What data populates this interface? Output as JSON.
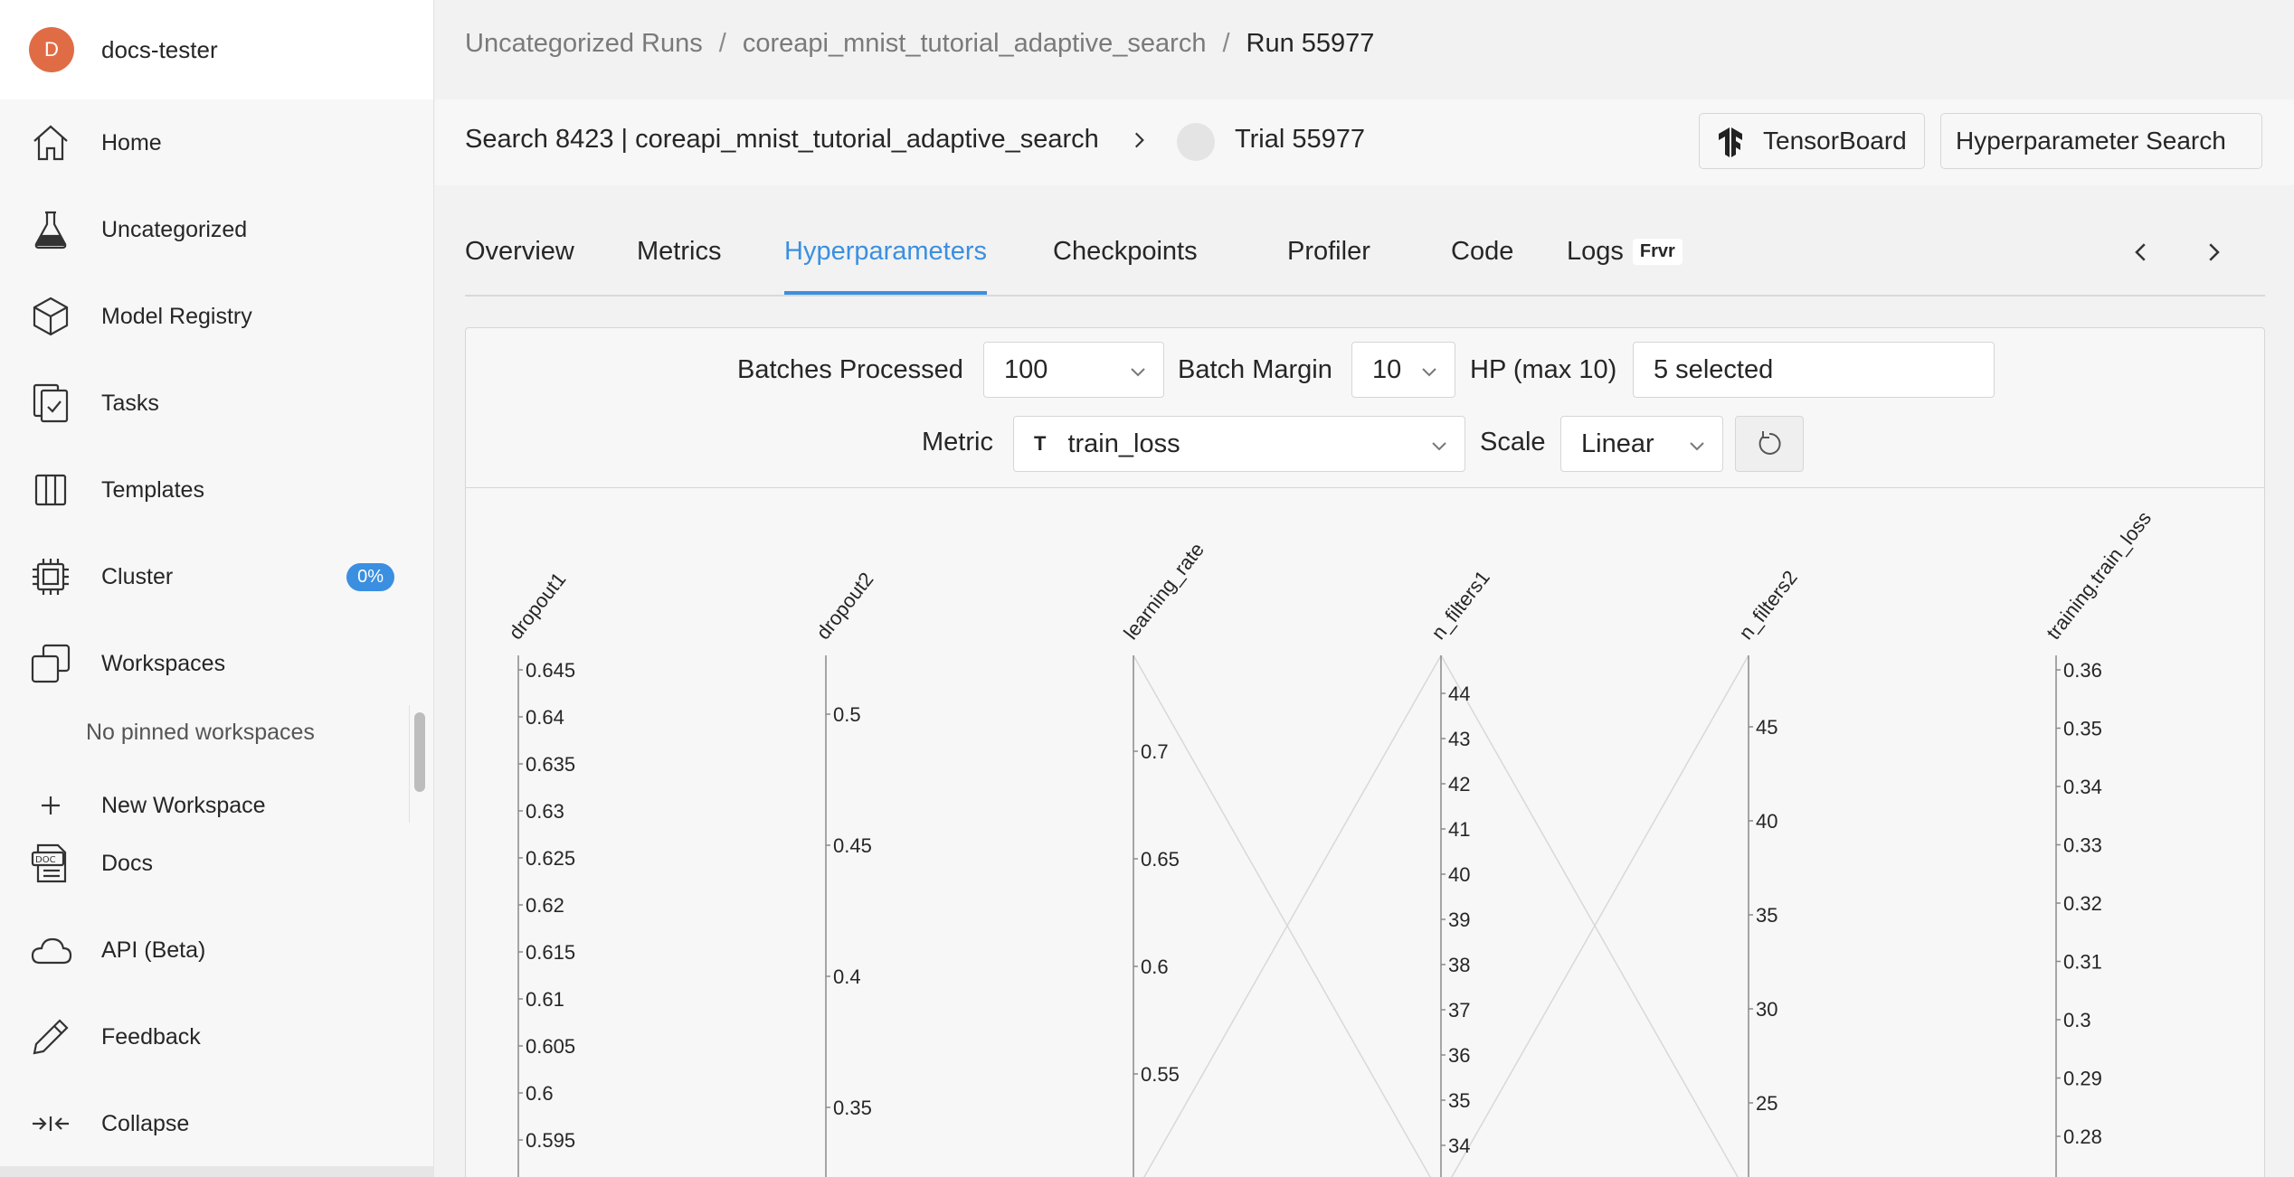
{
  "user": {
    "avatar_letter": "D",
    "name": "docs-tester"
  },
  "sidebar": {
    "items": [
      {
        "label": "Home",
        "icon": "home-icon"
      },
      {
        "label": "Uncategorized",
        "icon": "flask-icon"
      },
      {
        "label": "Model Registry",
        "icon": "cube-icon"
      },
      {
        "label": "Tasks",
        "icon": "tasks-icon"
      },
      {
        "label": "Templates",
        "icon": "templates-icon"
      },
      {
        "label": "Cluster",
        "icon": "chip-icon",
        "badge": "0%"
      },
      {
        "label": "Workspaces",
        "icon": "workspaces-icon"
      }
    ],
    "no_pinned": "No pinned workspaces",
    "new_workspace": "New Workspace",
    "bottom_items": [
      {
        "label": "Docs",
        "icon": "doc-icon"
      },
      {
        "label": "API (Beta)",
        "icon": "cloud-icon"
      },
      {
        "label": "Feedback",
        "icon": "pencil-icon"
      },
      {
        "label": "Collapse",
        "icon": "collapse-icon"
      }
    ]
  },
  "breadcrumb": {
    "items": [
      "Uncategorized Runs",
      "coreapi_mnist_tutorial_adaptive_search",
      "Run 55977"
    ],
    "separator": "/"
  },
  "header": {
    "search_link": "Search 8423 | coreapi_mnist_tutorial_adaptive_search",
    "trial": "Trial 55977",
    "tensorboard_button": "TensorBoard",
    "hp_search_button": "Hyperparameter Search"
  },
  "tabs": {
    "items": [
      "Overview",
      "Metrics",
      "Hyperparameters",
      "Checkpoints",
      "Profiler",
      "Code",
      "Logs"
    ],
    "active": "Hyperparameters",
    "logs_badge": "Frvr"
  },
  "controls": {
    "batches_processed_label": "Batches Processed",
    "batches_processed_value": "100",
    "batch_margin_label": "Batch Margin",
    "batch_margin_value": "10",
    "hp_label": "HP (max 10)",
    "hp_value": "5 selected",
    "metric_label": "Metric",
    "metric_type": "T",
    "metric_value": "train_loss",
    "scale_label": "Scale",
    "scale_value": "Linear"
  },
  "chart_data": {
    "type": "parallel_coordinates",
    "axes": [
      {
        "name": "dropout1",
        "ticks": [
          "0.645",
          "0.64",
          "0.635",
          "0.63",
          "0.625",
          "0.62",
          "0.615",
          "0.61",
          "0.605",
          "0.6",
          "0.595"
        ]
      },
      {
        "name": "dropout2",
        "ticks": [
          "0.5",
          "0.45",
          "0.4",
          "0.35"
        ]
      },
      {
        "name": "learning_rate",
        "ticks": [
          "0.7",
          "0.65",
          "0.6",
          "0.55"
        ]
      },
      {
        "name": "n_filters1",
        "ticks": [
          "44",
          "43",
          "42",
          "41",
          "40",
          "39",
          "38",
          "37",
          "36",
          "35",
          "34"
        ]
      },
      {
        "name": "n_filters2",
        "ticks": [
          "45",
          "40",
          "35",
          "30",
          "25"
        ]
      },
      {
        "name": "training.train_loss",
        "ticks": [
          "0.36",
          "0.35",
          "0.34",
          "0.33",
          "0.32",
          "0.31",
          "0.3",
          "0.29",
          "0.28"
        ]
      }
    ]
  },
  "colors": {
    "accent": "#3b8fe0",
    "avatar": "#e06c45"
  }
}
